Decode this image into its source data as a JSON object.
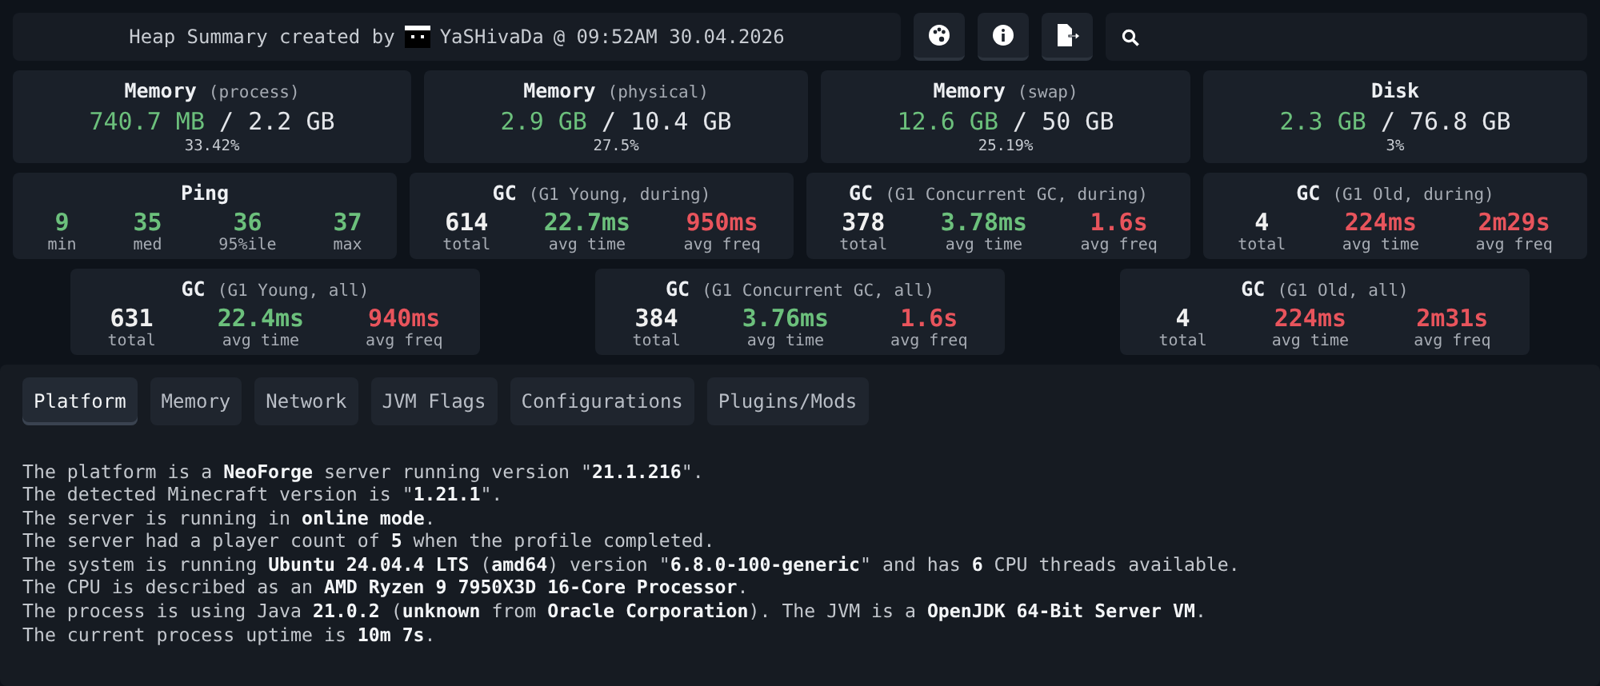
{
  "header": {
    "title_prefix": "Heap Summary created by",
    "user": "YaSHivaDa",
    "title_suffix": "@ 09:52AM 30.04.2026"
  },
  "memory_cards": [
    {
      "title": "Memory",
      "subtitle": "(process)",
      "used": "740.7 MB",
      "total": "/ 2.2 GB",
      "percent": "33.42%"
    },
    {
      "title": "Memory",
      "subtitle": "(physical)",
      "used": "2.9 GB",
      "total": "/ 10.4 GB",
      "percent": "27.5%"
    },
    {
      "title": "Memory",
      "subtitle": "(swap)",
      "used": "12.6 GB",
      "total": "/ 50 GB",
      "percent": "25.19%"
    },
    {
      "title": "Disk",
      "used": "2.3 GB",
      "total": "/ 76.8 GB",
      "percent": "3%"
    }
  ],
  "stat_cards": [
    {
      "title": "Ping",
      "stats": [
        {
          "value": "9",
          "label": "min",
          "color": "#6cc07c"
        },
        {
          "value": "35",
          "label": "med",
          "color": "#6cc07c"
        },
        {
          "value": "36",
          "label": "95%ile",
          "color": "#6cc07c"
        },
        {
          "value": "37",
          "label": "max",
          "color": "#6cc07c"
        }
      ]
    },
    {
      "title": "GC",
      "subtitle": "(G1 Young, during)",
      "stats": [
        {
          "value": "614",
          "label": "total",
          "color": "#f0f0f0"
        },
        {
          "value": "22.7ms",
          "label": "avg time",
          "color": "#6cc07c"
        },
        {
          "value": "950ms",
          "label": "avg freq",
          "color": "#e8545c"
        }
      ]
    },
    {
      "title": "GC",
      "subtitle": "(G1 Concurrent GC, during)",
      "stats": [
        {
          "value": "378",
          "label": "total",
          "color": "#f0f0f0"
        },
        {
          "value": "3.78ms",
          "label": "avg time",
          "color": "#6cc07c"
        },
        {
          "value": "1.6s",
          "label": "avg freq",
          "color": "#e8545c"
        }
      ]
    },
    {
      "title": "GC",
      "subtitle": "(G1 Old, during)",
      "stats": [
        {
          "value": "4",
          "label": "total",
          "color": "#f0f0f0"
        },
        {
          "value": "224ms",
          "label": "avg time",
          "color": "#e8545c"
        },
        {
          "value": "2m29s",
          "label": "avg freq",
          "color": "#e8545c"
        }
      ]
    }
  ],
  "gc_all_cards": [
    {
      "title": "GC",
      "subtitle": "(G1 Young, all)",
      "stats": [
        {
          "value": "631",
          "label": "total",
          "color": "#f0f0f0"
        },
        {
          "value": "22.4ms",
          "label": "avg time",
          "color": "#6cc07c"
        },
        {
          "value": "940ms",
          "label": "avg freq",
          "color": "#e8545c"
        }
      ]
    },
    {
      "title": "GC",
      "subtitle": "(G1 Concurrent GC, all)",
      "stats": [
        {
          "value": "384",
          "label": "total",
          "color": "#f0f0f0"
        },
        {
          "value": "3.76ms",
          "label": "avg time",
          "color": "#6cc07c"
        },
        {
          "value": "1.6s",
          "label": "avg freq",
          "color": "#e8545c"
        }
      ]
    },
    {
      "title": "GC",
      "subtitle": "(G1 Old, all)",
      "stats": [
        {
          "value": "4",
          "label": "total",
          "color": "#f0f0f0"
        },
        {
          "value": "224ms",
          "label": "avg time",
          "color": "#e8545c"
        },
        {
          "value": "2m31s",
          "label": "avg freq",
          "color": "#e8545c"
        }
      ]
    }
  ],
  "tabs": [
    {
      "label": "Platform",
      "selected": true
    },
    {
      "label": "Memory",
      "selected": false
    },
    {
      "label": "Network",
      "selected": false
    },
    {
      "label": "JVM Flags",
      "selected": false
    },
    {
      "label": "Configurations",
      "selected": false
    },
    {
      "label": "Plugins/Mods",
      "selected": false
    }
  ],
  "platform_lines": [
    "The platform is a **NeoForge** server running version \"**21.1.216**\".",
    "The detected Minecraft version is \"**1.21.1**\".",
    "The server is running in **online mode**.",
    "The server had a player count of **5** when the profile completed.",
    "The system is running **Ubuntu 24.04.4 LTS** (**amd64**) version \"**6.8.0-100-generic**\" and has **6** CPU threads available.",
    "The CPU is described as an **AMD Ryzen 9 7950X3D 16-Core Processor**.",
    "The process is using Java **21.0.2** (**unknown** from **Oracle Corporation**). The JVM is a **OpenJDK 64-Bit Server VM**.",
    "The current process uptime is **10m 7s**."
  ]
}
